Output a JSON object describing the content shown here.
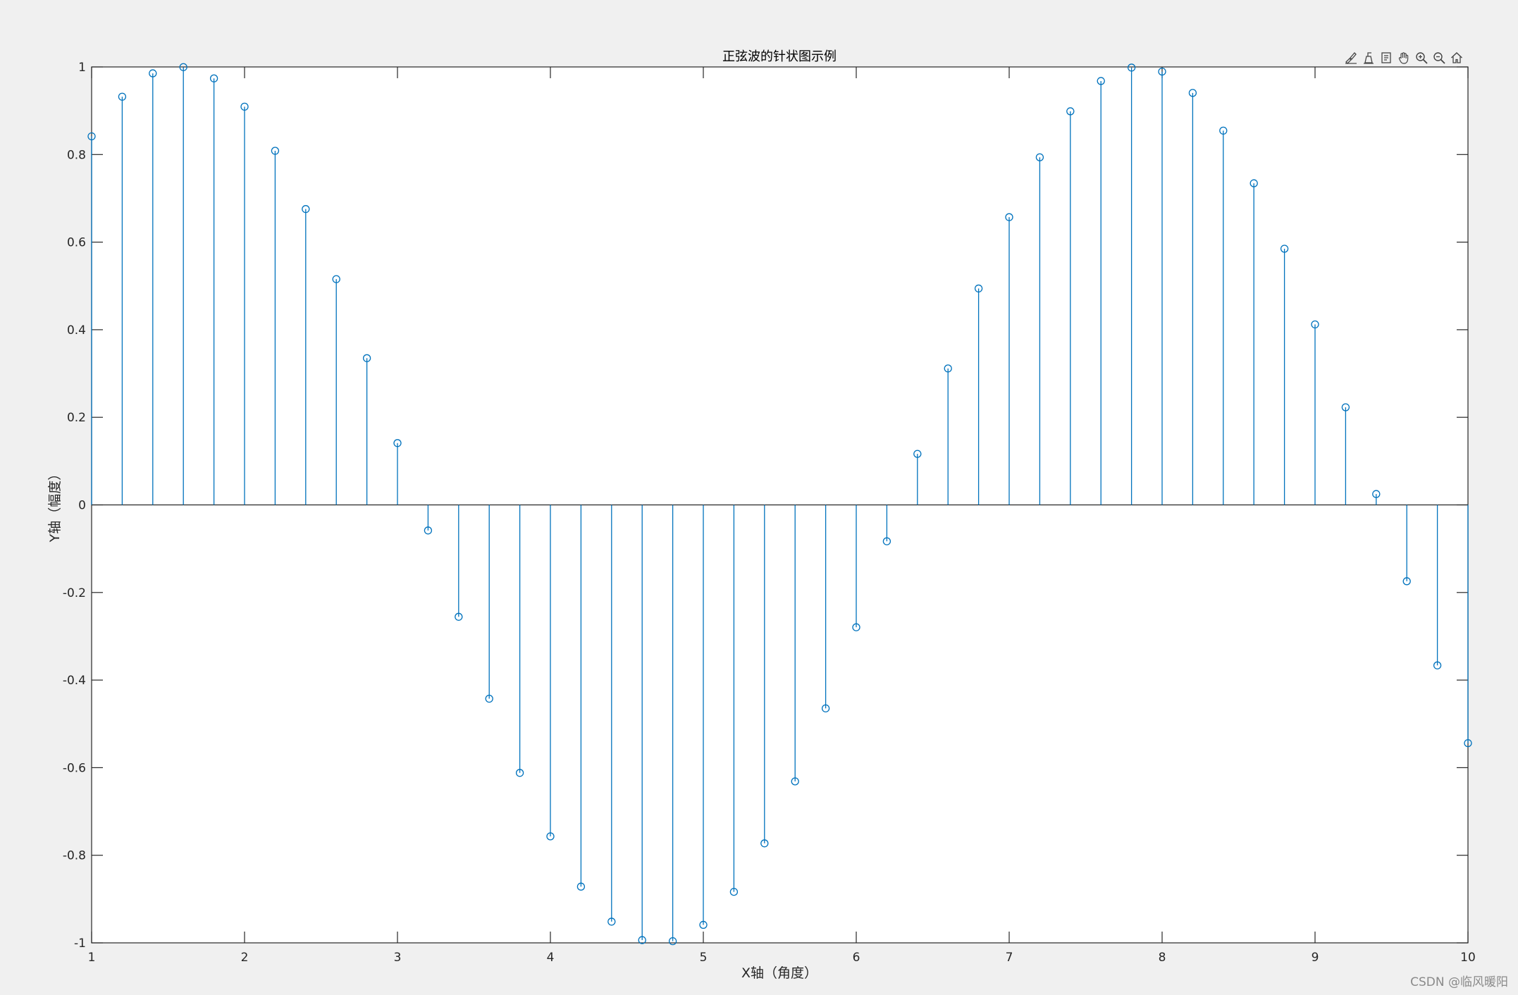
{
  "chart_data": {
    "type": "stem",
    "title": "正弦波的针状图示例",
    "xlabel": "X轴（角度）",
    "ylabel": "Y轴（幅度）",
    "xlim": [
      1,
      10
    ],
    "ylim": [
      -1,
      1
    ],
    "xticks": [
      1,
      2,
      3,
      4,
      5,
      6,
      7,
      8,
      9,
      10
    ],
    "yticks": [
      -1,
      -0.8,
      -0.6,
      -0.4,
      -0.2,
      0,
      0.2,
      0.4,
      0.6,
      0.8,
      1
    ],
    "color": "#0072bd",
    "marker": "circle-open",
    "x": [
      1.0,
      1.2,
      1.4,
      1.6,
      1.8,
      2.0,
      2.2,
      2.4,
      2.6,
      2.8,
      3.0,
      3.2,
      3.4,
      3.6,
      3.8,
      4.0,
      4.2,
      4.4,
      4.6,
      4.8,
      5.0,
      5.2,
      5.4,
      5.6,
      5.8,
      6.0,
      6.2,
      6.4,
      6.6,
      6.8,
      7.0,
      7.2,
      7.4,
      7.6,
      7.8,
      8.0,
      8.2,
      8.4,
      8.6,
      8.8,
      9.0,
      9.2,
      9.4,
      9.6,
      9.8,
      10.0
    ],
    "values": [
      0.8415,
      0.932,
      0.9854,
      0.9996,
      0.9738,
      0.9093,
      0.8085,
      0.6755,
      0.5155,
      0.335,
      0.1411,
      -0.0584,
      -0.2555,
      -0.4425,
      -0.6119,
      -0.7568,
      -0.8716,
      -0.9516,
      -0.9937,
      -0.9962,
      -0.9589,
      -0.8835,
      -0.7728,
      -0.6313,
      -0.4646,
      -0.2794,
      -0.0831,
      0.1165,
      0.3115,
      0.4941,
      0.657,
      0.7937,
      0.8987,
      0.9679,
      0.9985,
      0.9894,
      0.9407,
      0.8546,
      0.7344,
      0.5849,
      0.4121,
      0.2229,
      0.0248,
      -0.1743,
      -0.3665,
      -0.544
    ]
  },
  "toolbar": {
    "icons": [
      "brush-icon",
      "data-tips-icon",
      "export-icon",
      "pan-hand-icon",
      "zoom-in-icon",
      "zoom-out-icon",
      "home-icon"
    ]
  },
  "watermark": "CSDN @临风暖阳"
}
